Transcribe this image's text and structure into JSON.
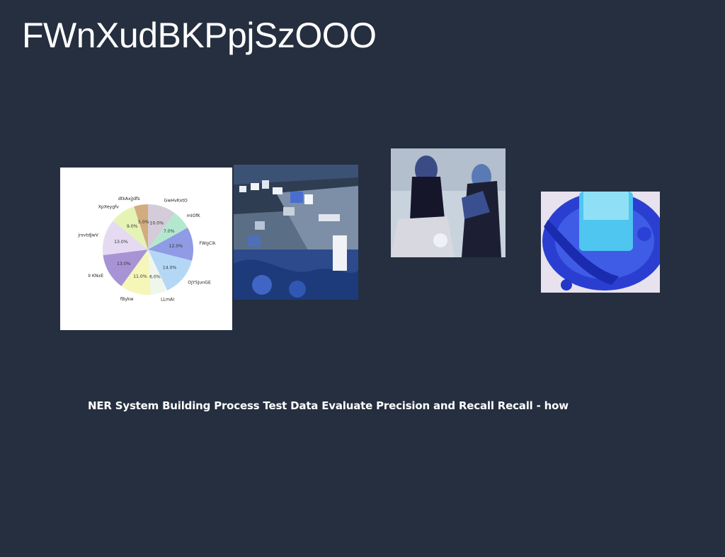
{
  "slide": {
    "title": "FWnXudBKPpjSzOOO",
    "caption": "NER System Building Process Test Data Evaluate Precision and Recall Recall - how"
  },
  "chart_data": {
    "type": "pie",
    "title": "",
    "labels": [
      "GwHvKxtO",
      "mIOfK",
      "FWgCik",
      "OjYSJunGE",
      "LLmAI",
      "fBykw",
      "II KNxE",
      "jrsvtdJwV",
      "XpXeygfv",
      "dtkAxjJdfs"
    ],
    "values": [
      10.0,
      7.0,
      12.0,
      14.0,
      6.0,
      11.0,
      13.0,
      13.0,
      9.0,
      5.0
    ],
    "percent_labels": [
      "10.0%",
      "7.0%",
      "12.0%",
      "14.0%",
      "6.0%",
      "11.0%",
      "13.0%",
      "13.0%",
      "9.0%",
      "5.0%"
    ],
    "colors": [
      "#d4ccd8",
      "#b3e8cf",
      "#8f9be4",
      "#b5d7f6",
      "#eff7ec",
      "#f5f6b8",
      "#a893d4",
      "#e5daf1",
      "#e5f4b4",
      "#d2ac7e"
    ],
    "start_angle_deg": 90,
    "direction": "clockwise"
  },
  "images": {
    "harbor": "harbor village photo",
    "women": "two women photo",
    "drink": "blue drink photo"
  }
}
